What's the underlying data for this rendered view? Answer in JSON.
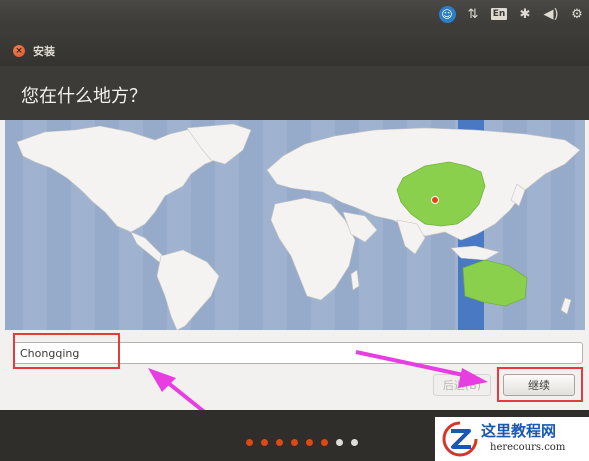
{
  "panel": {
    "icons": [
      "accessibility-icon",
      "network-icon",
      "keyboard-layout-icon",
      "bluetooth-icon",
      "volume-icon",
      "gear-icon"
    ],
    "keyboard_label": "En"
  },
  "window": {
    "title": "安装"
  },
  "page": {
    "title": "您在什么地方？"
  },
  "map": {
    "selected_region": "Asia/Shanghai",
    "colors": {
      "ocean": "#9fb3d1",
      "land": "#f4f3f1",
      "highlight": "#8bd04d",
      "timezone_band": "#3a6fc0"
    }
  },
  "timezone": {
    "value": "Chongqing"
  },
  "buttons": {
    "back": "后退(B)",
    "next": "继续"
  },
  "progress": {
    "completed": 6,
    "total": 8
  },
  "watermark": {
    "name": "这里教程网",
    "url": "herecours.com"
  },
  "colors": {
    "accent": "#dd4814",
    "annotation_red": "#e53b3b",
    "annotation_magenta": "#e83de1"
  }
}
